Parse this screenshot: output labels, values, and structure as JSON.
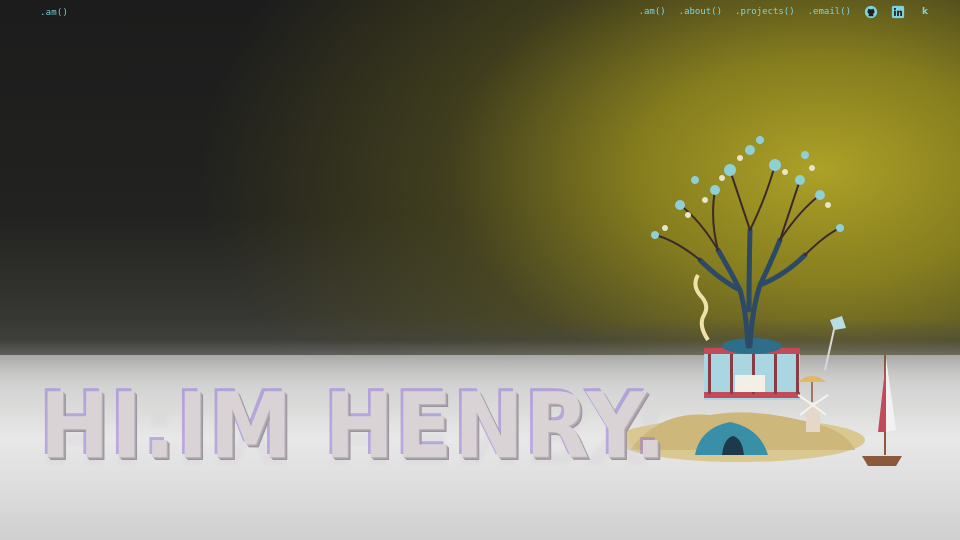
{
  "nav": {
    "logo": ".am()",
    "links": [
      ".am()",
      ".about()",
      ".projects()",
      ".email()"
    ],
    "icons": [
      "github-icon",
      "linkedin-icon",
      "k-icon"
    ],
    "k_glyph": "k"
  },
  "hero": {
    "headline": "HI.IM HENRY."
  },
  "colors": {
    "accent": "#7fd3de",
    "sky_glow": "#b4a828",
    "floor": "#e0e0e0",
    "headline": "#d9d3d6",
    "headline_shadow": "#9678dc"
  }
}
